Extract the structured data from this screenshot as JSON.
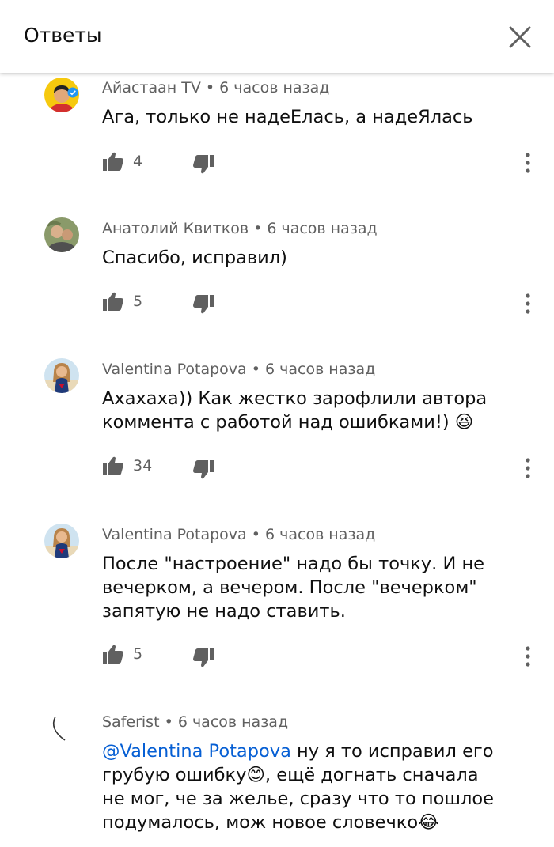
{
  "header": {
    "title": "Ответы"
  },
  "comments": [
    {
      "author": "Айастаан TV",
      "time": "6 часов назад",
      "text": "Ага, только не надеЕлась, а надеЯлась",
      "likes": "4",
      "verified": true
    },
    {
      "author": "Анатолий Квитков",
      "time": "6 часов назад",
      "text": "Спасибо, исправил)",
      "likes": "5"
    },
    {
      "author": "Valentina Potapova",
      "time": "6 часов назад",
      "text": "Ахахаха)) Как жестко зарофлили автора коммента с работой над ошибками!) 😆",
      "likes": "34"
    },
    {
      "author": "Valentina Potapova",
      "time": "6 часов назад",
      "text": "После \"настроение\" надо бы точку. И не вечерком, а вечером. После \"вечерком\" запятую не надо ставить.",
      "likes": "5"
    },
    {
      "author": "Saferist",
      "time": "6 часов назад",
      "mention": "@Valentina Potapova",
      "text": " ну я то исправил его грубую ошибку😊, ещё догнать сначала не мог, че за желье, сразу что то пошлое подумалось, мож новое словечко😂"
    }
  ],
  "meta_separator": " • ",
  "colors": {
    "accent_red": "#ff0000",
    "mention_blue": "#065fd4",
    "meta_gray": "#606060"
  },
  "icons": {
    "close": "close-icon",
    "like": "thumbs-up-icon",
    "dislike": "thumbs-down-icon",
    "more": "more-vert-icon",
    "verified": "verified-check-icon"
  }
}
